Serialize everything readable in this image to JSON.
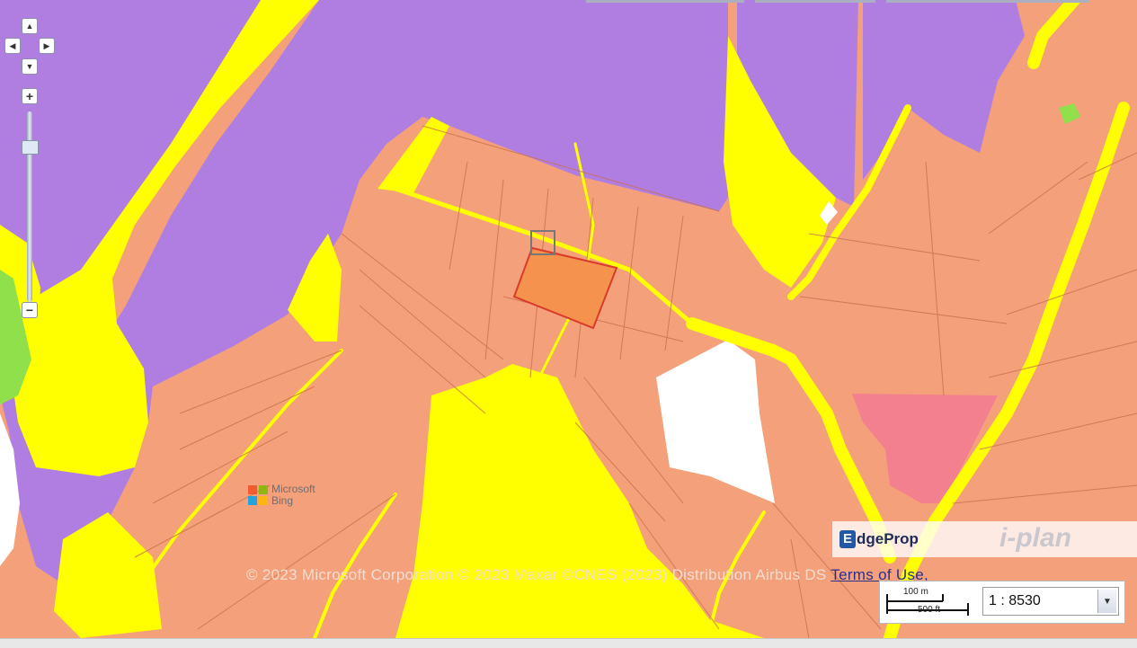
{
  "map": {
    "colors": {
      "residential": "#f4a07a",
      "institutional": "#b07ee0",
      "open_space": "#ffff00",
      "agriculture": "#8fe04a",
      "commercial": "#f2808f",
      "vacant": "#ffffff",
      "parcel_lines": "#c9704a",
      "selected_parcel": "#d93a2a"
    }
  },
  "navigation": {
    "pan_up": "▲",
    "pan_left": "◀",
    "pan_right": "▶",
    "pan_down": "▼",
    "zoom_in": "+",
    "zoom_out": "−"
  },
  "attribution": {
    "provider_name": "Microsoft",
    "provider_product": "Bing",
    "copyright": "© 2023 Microsoft Corporation © 2023 Maxar ©CNES (2023) Distribution Airbus DS",
    "terms_link": "Terms of Use",
    "terms_suffix": ","
  },
  "watermark": {
    "brand": "EdgeProp",
    "brand_initial": "E",
    "brand_rest": "dgeProp",
    "source": "i-plan"
  },
  "scale": {
    "metric_label": "100 m",
    "imperial_label": "500 ft",
    "ratio": "1 : 8530"
  }
}
